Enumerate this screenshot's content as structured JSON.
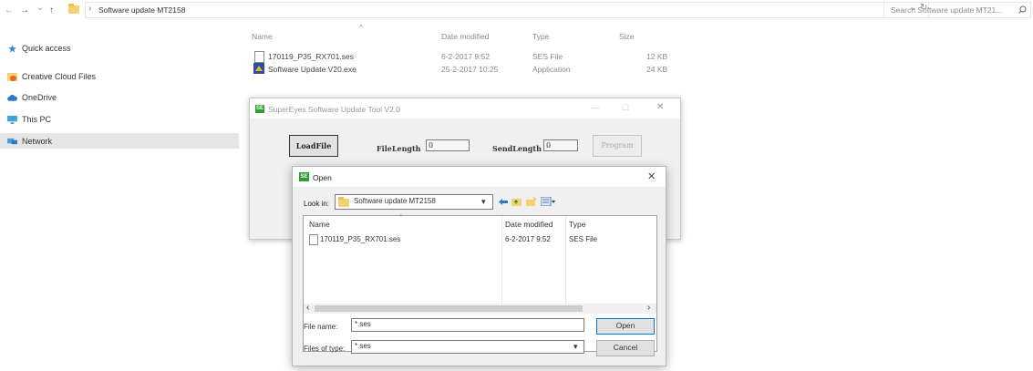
{
  "explorer": {
    "address_path": "Software update MT2158",
    "search_placeholder": "Search Software update MT21...",
    "nav": {
      "back": "←",
      "forward": "→",
      "recent": "⌄",
      "up": "↑",
      "separator": "›",
      "refresh": "↻",
      "dropdown": "⌄"
    },
    "sidebar": [
      {
        "label": "Quick access",
        "icon": "star-icon",
        "color": "#3b86d1"
      },
      {
        "label": "Creative Cloud Files",
        "icon": "creative-cloud-icon",
        "color": "#e8662a"
      },
      {
        "label": "OneDrive",
        "icon": "cloud-icon",
        "color": "#2f78c6"
      },
      {
        "label": "This PC",
        "icon": "monitor-icon",
        "color": "#3ea2e0"
      },
      {
        "label": "Network",
        "icon": "network-icon",
        "color": "#3ea2e0"
      }
    ],
    "columns": {
      "name": "Name",
      "date": "Date modified",
      "type": "Type",
      "size": "Size",
      "sort_arrow": "^"
    },
    "files": [
      {
        "name": "170119_P35_RX701.ses",
        "date": "6-2-2017 9:52",
        "type": "SES File",
        "size": "12 KB",
        "icon": "file-icon"
      },
      {
        "name": "Software Update V20.exe",
        "date": "25-2-2017 10:25",
        "type": "Application",
        "size": "24 KB",
        "icon": "app-exe-icon"
      }
    ]
  },
  "tool": {
    "title": "SuperEyes Software Update Tool V2.0",
    "icon_text": "SE",
    "load_button": "LoadFile",
    "file_length_label": "FileLength",
    "file_length_value": "0",
    "send_length_label": "SendLength",
    "send_length_value": "0",
    "program_button": "Program",
    "controls": {
      "minimize": "—",
      "maximize": "☐",
      "close": "✕"
    }
  },
  "open_dialog": {
    "title": "Open",
    "icon_text": "SE",
    "close": "✕",
    "look_in_label": "Look in:",
    "look_in_value": "Software update MT2158",
    "columns": {
      "name": "Name",
      "date": "Date modified",
      "type": "Type",
      "sort_arrow": "^"
    },
    "files": [
      {
        "name": "170119_P35_RX701.ses",
        "date": "6-2-2017 9:52",
        "type": "SES File"
      }
    ],
    "scroll_left": "‹",
    "scroll_right": "›",
    "file_name_label": "File name:",
    "file_name_value": "*.ses",
    "files_of_type_label": "Files of type:",
    "files_of_type_value": "*.ses",
    "open_button": "Open",
    "cancel_button": "Cancel",
    "dropdown_arrow": "▾"
  }
}
